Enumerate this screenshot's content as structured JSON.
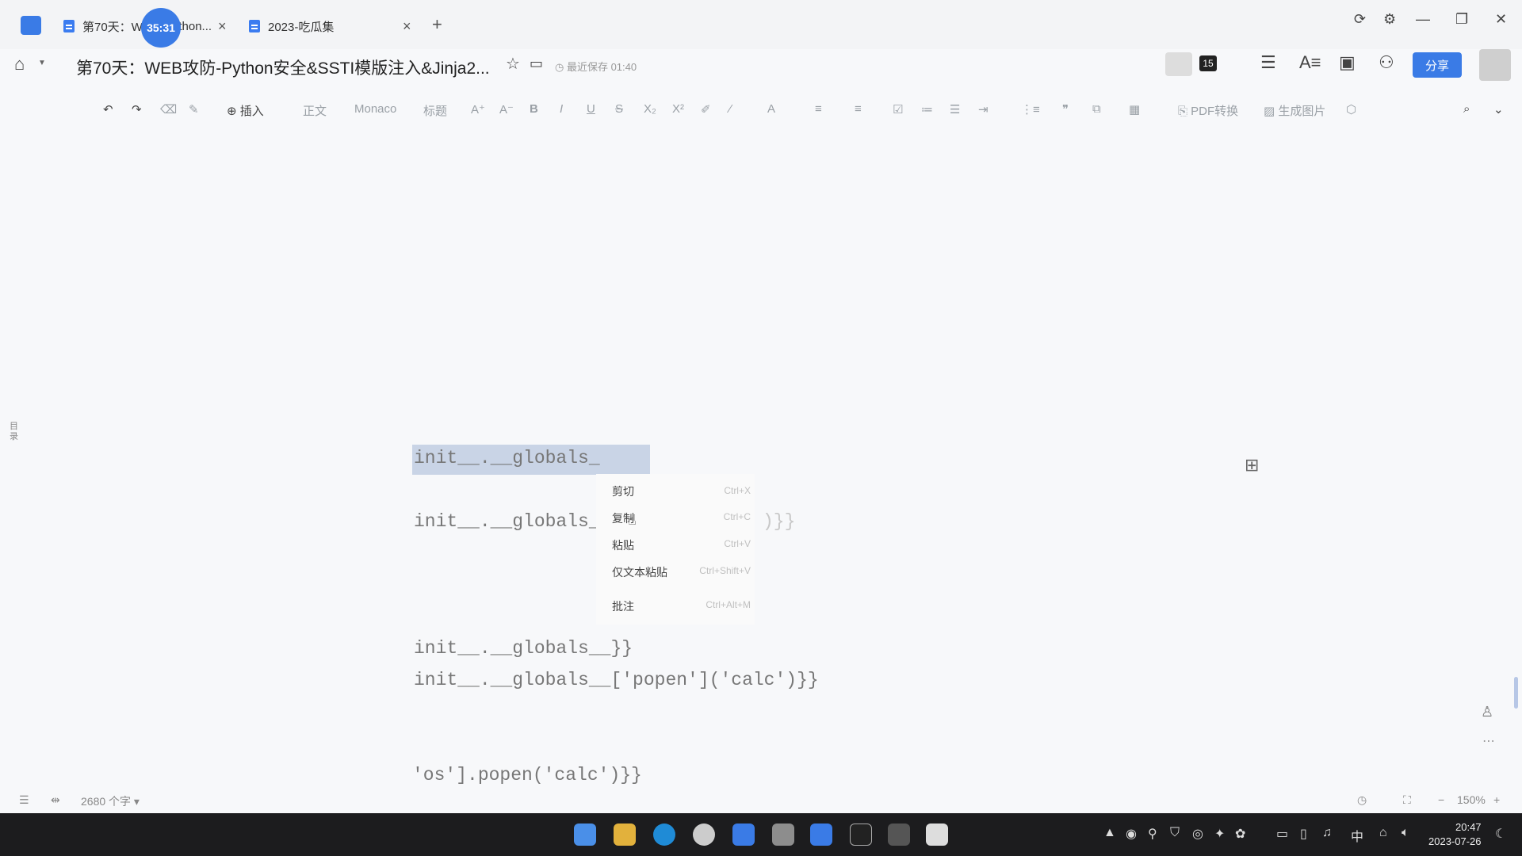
{
  "tabs": [
    {
      "label": "第70天：W",
      "label_tail": "ython..."
    },
    {
      "label": "2023-吃瓜集"
    }
  ],
  "timer": "35:31",
  "header": {
    "title": "第70天：WEB攻防-Python安全&SSTI模版注入&Jinja2...",
    "saved": "最近保存 01:40",
    "badge": "15",
    "share": "分享"
  },
  "toolbar": {
    "insert": "插入",
    "body": "正文",
    "font": "Monaco",
    "heading": "标题",
    "pdf": "PDF转换",
    "image": "生成图片"
  },
  "sidebar": {
    "outline": "目\n录"
  },
  "code": [
    "init__.__globals_",
    "init__.__globals_",
    "init__.__globals__}}",
    "init__.__globals__['popen']('calc')}}",
    "'os'].popen('calc')}}"
  ],
  "code_suffix": ")}}",
  "context_menu": [
    {
      "label": "剪切",
      "shortcut": "Ctrl+X"
    },
    {
      "label": "复制",
      "shortcut": "Ctrl+C"
    },
    {
      "label": "粘贴",
      "shortcut": "Ctrl+V"
    },
    {
      "label": "仅文本粘贴",
      "shortcut": "Ctrl+Shift+V"
    },
    {
      "label": "批注",
      "shortcut": "Ctrl+Alt+M"
    }
  ],
  "status": {
    "word_count": "2680 个字",
    "zoom": "150%"
  },
  "clock": {
    "time": "20:47",
    "date": "2023-07-26"
  },
  "tray": {
    "ime": "中"
  },
  "colors": {
    "accent": "#3a7be6",
    "taskbar": "#1c1c1e"
  }
}
